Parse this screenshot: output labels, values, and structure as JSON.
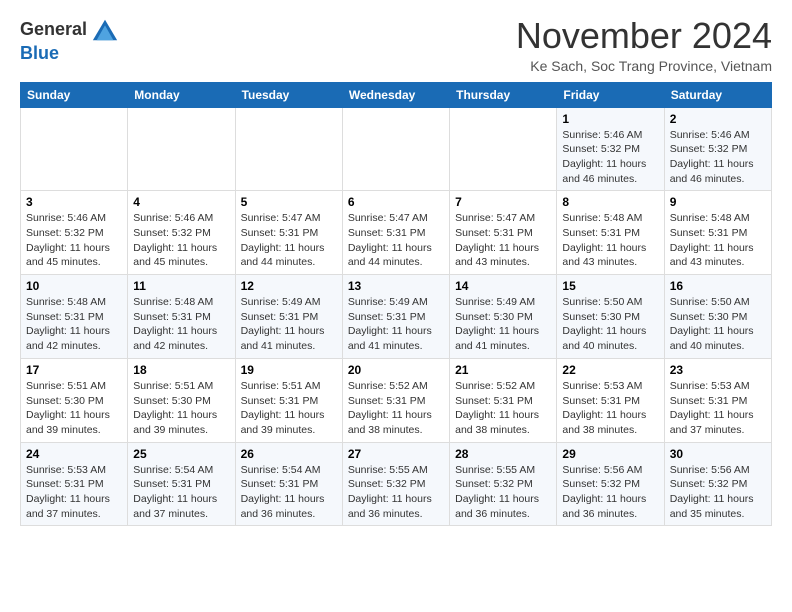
{
  "logo": {
    "general": "General",
    "blue": "Blue"
  },
  "title": "November 2024",
  "subtitle": "Ke Sach, Soc Trang Province, Vietnam",
  "weekdays": [
    "Sunday",
    "Monday",
    "Tuesday",
    "Wednesday",
    "Thursday",
    "Friday",
    "Saturday"
  ],
  "weeks": [
    [
      {
        "day": "",
        "info": ""
      },
      {
        "day": "",
        "info": ""
      },
      {
        "day": "",
        "info": ""
      },
      {
        "day": "",
        "info": ""
      },
      {
        "day": "",
        "info": ""
      },
      {
        "day": "1",
        "info": "Sunrise: 5:46 AM\nSunset: 5:32 PM\nDaylight: 11 hours and 46 minutes."
      },
      {
        "day": "2",
        "info": "Sunrise: 5:46 AM\nSunset: 5:32 PM\nDaylight: 11 hours and 46 minutes."
      }
    ],
    [
      {
        "day": "3",
        "info": "Sunrise: 5:46 AM\nSunset: 5:32 PM\nDaylight: 11 hours and 45 minutes."
      },
      {
        "day": "4",
        "info": "Sunrise: 5:46 AM\nSunset: 5:32 PM\nDaylight: 11 hours and 45 minutes."
      },
      {
        "day": "5",
        "info": "Sunrise: 5:47 AM\nSunset: 5:31 PM\nDaylight: 11 hours and 44 minutes."
      },
      {
        "day": "6",
        "info": "Sunrise: 5:47 AM\nSunset: 5:31 PM\nDaylight: 11 hours and 44 minutes."
      },
      {
        "day": "7",
        "info": "Sunrise: 5:47 AM\nSunset: 5:31 PM\nDaylight: 11 hours and 43 minutes."
      },
      {
        "day": "8",
        "info": "Sunrise: 5:48 AM\nSunset: 5:31 PM\nDaylight: 11 hours and 43 minutes."
      },
      {
        "day": "9",
        "info": "Sunrise: 5:48 AM\nSunset: 5:31 PM\nDaylight: 11 hours and 43 minutes."
      }
    ],
    [
      {
        "day": "10",
        "info": "Sunrise: 5:48 AM\nSunset: 5:31 PM\nDaylight: 11 hours and 42 minutes."
      },
      {
        "day": "11",
        "info": "Sunrise: 5:48 AM\nSunset: 5:31 PM\nDaylight: 11 hours and 42 minutes."
      },
      {
        "day": "12",
        "info": "Sunrise: 5:49 AM\nSunset: 5:31 PM\nDaylight: 11 hours and 41 minutes."
      },
      {
        "day": "13",
        "info": "Sunrise: 5:49 AM\nSunset: 5:31 PM\nDaylight: 11 hours and 41 minutes."
      },
      {
        "day": "14",
        "info": "Sunrise: 5:49 AM\nSunset: 5:30 PM\nDaylight: 11 hours and 41 minutes."
      },
      {
        "day": "15",
        "info": "Sunrise: 5:50 AM\nSunset: 5:30 PM\nDaylight: 11 hours and 40 minutes."
      },
      {
        "day": "16",
        "info": "Sunrise: 5:50 AM\nSunset: 5:30 PM\nDaylight: 11 hours and 40 minutes."
      }
    ],
    [
      {
        "day": "17",
        "info": "Sunrise: 5:51 AM\nSunset: 5:30 PM\nDaylight: 11 hours and 39 minutes."
      },
      {
        "day": "18",
        "info": "Sunrise: 5:51 AM\nSunset: 5:30 PM\nDaylight: 11 hours and 39 minutes."
      },
      {
        "day": "19",
        "info": "Sunrise: 5:51 AM\nSunset: 5:31 PM\nDaylight: 11 hours and 39 minutes."
      },
      {
        "day": "20",
        "info": "Sunrise: 5:52 AM\nSunset: 5:31 PM\nDaylight: 11 hours and 38 minutes."
      },
      {
        "day": "21",
        "info": "Sunrise: 5:52 AM\nSunset: 5:31 PM\nDaylight: 11 hours and 38 minutes."
      },
      {
        "day": "22",
        "info": "Sunrise: 5:53 AM\nSunset: 5:31 PM\nDaylight: 11 hours and 38 minutes."
      },
      {
        "day": "23",
        "info": "Sunrise: 5:53 AM\nSunset: 5:31 PM\nDaylight: 11 hours and 37 minutes."
      }
    ],
    [
      {
        "day": "24",
        "info": "Sunrise: 5:53 AM\nSunset: 5:31 PM\nDaylight: 11 hours and 37 minutes."
      },
      {
        "day": "25",
        "info": "Sunrise: 5:54 AM\nSunset: 5:31 PM\nDaylight: 11 hours and 37 minutes."
      },
      {
        "day": "26",
        "info": "Sunrise: 5:54 AM\nSunset: 5:31 PM\nDaylight: 11 hours and 36 minutes."
      },
      {
        "day": "27",
        "info": "Sunrise: 5:55 AM\nSunset: 5:32 PM\nDaylight: 11 hours and 36 minutes."
      },
      {
        "day": "28",
        "info": "Sunrise: 5:55 AM\nSunset: 5:32 PM\nDaylight: 11 hours and 36 minutes."
      },
      {
        "day": "29",
        "info": "Sunrise: 5:56 AM\nSunset: 5:32 PM\nDaylight: 11 hours and 36 minutes."
      },
      {
        "day": "30",
        "info": "Sunrise: 5:56 AM\nSunset: 5:32 PM\nDaylight: 11 hours and 35 minutes."
      }
    ]
  ]
}
